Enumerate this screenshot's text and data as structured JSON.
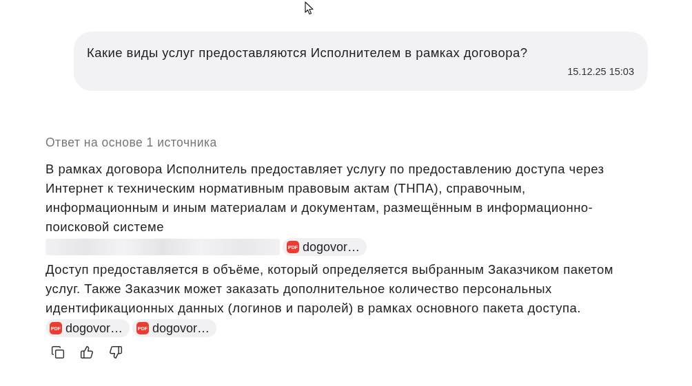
{
  "question": {
    "text": "Какие виды услуг предоставляются Исполнителем в рамках договора?",
    "time": "15.12.25 15:03"
  },
  "answer": {
    "heading": "Ответ на основе 1 источника",
    "paragraphs": [
      {
        "text": "В рамках договора Исполнитель предоставляет услугу по предоставлению доступа через Интернет к техническим нормативным правовым актам (ТНПА), справочным, информационным и иным материалам и документам, размещённым в информационно-поисковой системе",
        "redacted": true,
        "sources": [
          {
            "badge": "PDF",
            "name": "dogovor…"
          }
        ]
      },
      {
        "text": "Доступ предоставляется в объёме, который определяется выбранным Заказчиком пакетом услуг. Также Заказчик может заказать дополнительное количество персональных идентификационных данных (логинов и паролей) в рамках основного пакета доступа.",
        "redacted": false,
        "sources": [
          {
            "badge": "PDF",
            "name": "dogovor…"
          },
          {
            "badge": "PDF",
            "name": "dogovor…"
          }
        ]
      }
    ]
  },
  "actions": [
    {
      "kind": "copy"
    },
    {
      "kind": "like"
    },
    {
      "kind": "dislike"
    }
  ]
}
